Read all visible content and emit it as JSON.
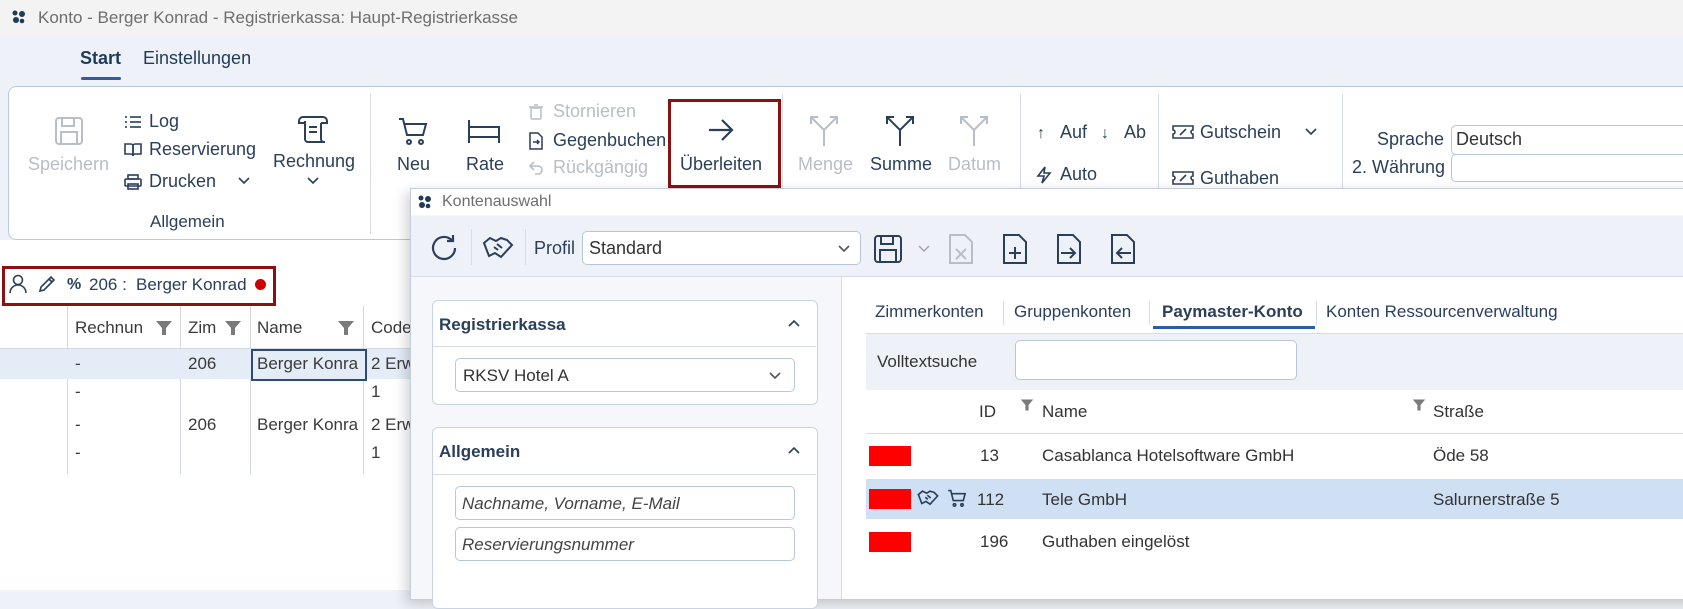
{
  "window": {
    "title": "Konto - Berger Konrad - Registrierkassa: Haupt-Registrierkasse",
    "icon": "app-logo-icon"
  },
  "tabs": [
    {
      "label": "Start",
      "active": true
    },
    {
      "label": "Einstellungen",
      "active": false
    }
  ],
  "ribbon": {
    "save": "Speichern",
    "log": "Log",
    "reservation": "Reservierung",
    "print": "Drucken",
    "invoice": "Rechnung",
    "group_general": "Allgemein",
    "new": "Neu",
    "rate": "Rate",
    "storno": "Stornieren",
    "counterbook": "Gegenbuchen",
    "undo": "Rückgängig",
    "transfer": "Überleiten",
    "quantity": "Menge",
    "sum": "Summe",
    "date": "Datum",
    "up": "Auf",
    "down": "Ab",
    "auto": "Auto",
    "voucher": "Gutschein",
    "credit": "Guthaben",
    "language_label": "Sprache",
    "language_value": "Deutsch",
    "currency2_label": "2. Währung",
    "currency2_value": ""
  },
  "guest": {
    "percent": "%",
    "room": "206 :",
    "name": "Berger Konrad",
    "status_color": "#cc0000"
  },
  "grid": {
    "columns": [
      "Rechnun",
      "Zim",
      "Name",
      "Code"
    ],
    "rows": [
      [
        "-",
        "206",
        "Berger Konra",
        "2 Erw"
      ],
      [
        "-",
        "",
        "",
        "1"
      ],
      [
        "-",
        "206",
        "Berger Konra",
        "2 Erw"
      ],
      [
        "-",
        "",
        "",
        "1"
      ]
    ]
  },
  "dialog": {
    "title": "Kontenauswahl",
    "profile_label": "Profil",
    "profile_value": "Standard",
    "register_panel": {
      "title": "Registrierkassa",
      "value": "RKSV Hotel A"
    },
    "general_panel": {
      "title": "Allgemein",
      "name_placeholder": "Nachname, Vorname, E-Mail",
      "reservation_placeholder": "Reservierungsnummer"
    },
    "tabs": [
      "Zimmerkonten",
      "Gruppenkonten",
      "Paymaster-Konto",
      "Konten Ressourcenverwaltung"
    ],
    "active_tab": "Paymaster-Konto",
    "search_label": "Volltextsuche",
    "search_value": "",
    "columns": {
      "id": "ID",
      "name": "Name",
      "street": "Straße"
    },
    "rows": [
      {
        "id": "13",
        "name": "Casablanca Hotelsoftware GmbH",
        "street": "Öde 58",
        "selected": false
      },
      {
        "id": "112",
        "name": "Tele GmbH",
        "street": "Salurnerstraße 5",
        "selected": true
      },
      {
        "id": "196",
        "name": "Guthaben eingelöst",
        "street": "",
        "selected": false
      }
    ],
    "accent": "#ff0000",
    "selected_row_color": "#cfe0f5"
  }
}
